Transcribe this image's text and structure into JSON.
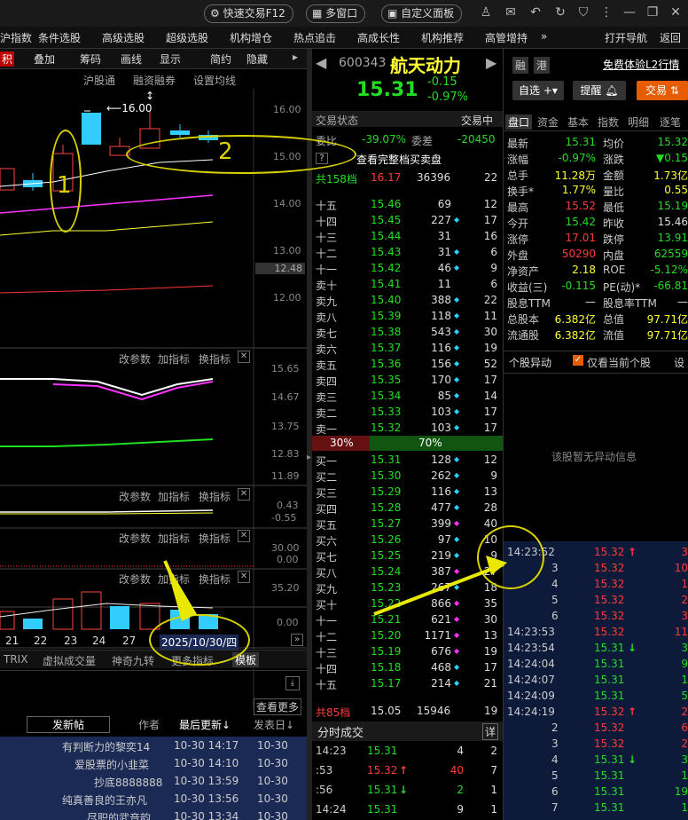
{
  "topbar": {
    "quick_trade": "快速交易F12",
    "multi_window": "多窗口",
    "custom_panel": "自定义面板"
  },
  "menu": [
    "沪指数",
    "条件选股",
    "高级选股",
    "超级选股",
    "机构增仓",
    "热点追击",
    "高成长性",
    "机构推荐",
    "高管增持",
    "»",
    "打开导航",
    "返回"
  ],
  "chart_toolbar": [
    "积",
    "叠加",
    "筹码",
    "画线",
    "显示",
    "简约",
    "隐藏"
  ],
  "chart_links": [
    "沪股通",
    "融资融券",
    "设置均线"
  ],
  "price_axis": [
    "16.00",
    "15.00",
    "14.00",
    "13.00",
    "12.48",
    "12.00"
  ],
  "peak_label": "16.00",
  "ind_buttons": {
    "params": "改参数",
    "add": "加指标",
    "switch": "换指标"
  },
  "ind_axis1": [
    "15.65",
    "14.67",
    "13.75",
    "12.83",
    "11.89"
  ],
  "ind_axis2": [
    "0.43",
    "-0.55"
  ],
  "ind_axis3": [
    "30.00",
    "0.00"
  ],
  "ind_axis4": [
    "35.20",
    "0.00"
  ],
  "dates": [
    "21",
    "22",
    "23",
    "24",
    "27"
  ],
  "date_tooltip": "2025/10/30/四",
  "bottom_tabs": [
    "TRIX",
    "虚拟成交量",
    "神奇九转",
    "更多指标",
    "模板"
  ],
  "forum": {
    "post_btn": "发新帖",
    "author": "作者",
    "last_update": "最后更新",
    "post_date": "发表日",
    "view_more": "查看更多",
    "rows": [
      {
        "author": "有判断力的黎奕14",
        "time": "10-30  14:17",
        "date": "10-30"
      },
      {
        "author": "爱股票的小韭菜",
        "time": "10-30  14:10",
        "date": "10-30"
      },
      {
        "author": "抄底8888888",
        "time": "10-30  13:59",
        "date": "10-30"
      },
      {
        "author": "纯真善良的王亦凡",
        "time": "10-30  13:56",
        "date": "10-30"
      },
      {
        "author": "尽职的武音韵",
        "time": "10-30  13:34",
        "date": "10-30"
      }
    ]
  },
  "stock": {
    "code": "600343",
    "name": "航天动力",
    "price": "15.31",
    "change": "-0.15",
    "pct": "-0.97%",
    "tags": [
      "融",
      "港"
    ],
    "l2": "免费体验L2行情",
    "zixuan": "自选",
    "remind": "提醒",
    "trade": "交易"
  },
  "trade_status": {
    "label": "交易状态",
    "value": "交易中"
  },
  "weibi": {
    "label1": "委比",
    "v1": "-39.07%",
    "label2": "委差",
    "v2": "-20450"
  },
  "full_book": "查看完整档买卖盘",
  "ask_total": {
    "label": "共158档",
    "price": "16.17",
    "vol": "36396",
    "n": "22"
  },
  "asks": [
    {
      "l": "十五",
      "p": "15.46",
      "v": "69",
      "d": "",
      "n": "12"
    },
    {
      "l": "十四",
      "p": "15.45",
      "v": "227",
      "d": "c",
      "n": "17"
    },
    {
      "l": "十三",
      "p": "15.44",
      "v": "31",
      "d": "",
      "n": "16"
    },
    {
      "l": "十二",
      "p": "15.43",
      "v": "31",
      "d": "c",
      "n": "6"
    },
    {
      "l": "十一",
      "p": "15.42",
      "v": "46",
      "d": "c",
      "n": "9"
    },
    {
      "l": "卖十",
      "p": "15.41",
      "v": "11",
      "d": "",
      "n": "6"
    },
    {
      "l": "卖九",
      "p": "15.40",
      "v": "388",
      "d": "c",
      "n": "22"
    },
    {
      "l": "卖八",
      "p": "15.39",
      "v": "118",
      "d": "c",
      "n": "11"
    },
    {
      "l": "卖七",
      "p": "15.38",
      "v": "543",
      "d": "c",
      "n": "30"
    },
    {
      "l": "卖六",
      "p": "15.37",
      "v": "116",
      "d": "c",
      "n": "19"
    },
    {
      "l": "卖五",
      "p": "15.36",
      "v": "156",
      "d": "c",
      "n": "52"
    },
    {
      "l": "卖四",
      "p": "15.35",
      "v": "170",
      "d": "c",
      "n": "17"
    },
    {
      "l": "卖三",
      "p": "15.34",
      "v": "85",
      "d": "c",
      "n": "14"
    },
    {
      "l": "卖二",
      "p": "15.33",
      "v": "103",
      "d": "c",
      "n": "17"
    },
    {
      "l": "卖一",
      "p": "15.32",
      "v": "103",
      "d": "c",
      "n": "17"
    }
  ],
  "ratio": {
    "sell": "30%",
    "buy": "70%",
    "sell_frac": 0.3
  },
  "bids": [
    {
      "l": "买一",
      "p": "15.31",
      "v": "128",
      "d": "c",
      "n": "12"
    },
    {
      "l": "买二",
      "p": "15.30",
      "v": "262",
      "d": "c",
      "n": "9"
    },
    {
      "l": "买三",
      "p": "15.29",
      "v": "116",
      "d": "c",
      "n": "13"
    },
    {
      "l": "买四",
      "p": "15.28",
      "v": "477",
      "d": "c",
      "n": "28"
    },
    {
      "l": "买五",
      "p": "15.27",
      "v": "399",
      "d": "m",
      "n": "40"
    },
    {
      "l": "买六",
      "p": "15.26",
      "v": "97",
      "d": "c",
      "n": "10"
    },
    {
      "l": "买七",
      "p": "15.25",
      "v": "219",
      "d": "c",
      "n": "9"
    },
    {
      "l": "买八",
      "p": "15.24",
      "v": "387",
      "d": "m",
      "n": "27"
    },
    {
      "l": "买九",
      "p": "15.23",
      "v": "267",
      "d": "c",
      "n": "18"
    },
    {
      "l": "买十",
      "p": "15.22",
      "v": "866",
      "d": "m",
      "n": "35"
    },
    {
      "l": "十一",
      "p": "15.21",
      "v": "621",
      "d": "m",
      "n": "30"
    },
    {
      "l": "十二",
      "p": "15.20",
      "v": "1171",
      "d": "m",
      "n": "13"
    },
    {
      "l": "十三",
      "p": "15.19",
      "v": "676",
      "d": "m",
      "n": "19"
    },
    {
      "l": "十四",
      "p": "15.18",
      "v": "468",
      "d": "c",
      "n": "17"
    },
    {
      "l": "十五",
      "p": "15.17",
      "v": "214",
      "d": "c",
      "n": "21"
    }
  ],
  "bid_total": {
    "label": "共85档",
    "price": "15.05",
    "vol": "15946",
    "n": "19"
  },
  "fenshi": {
    "label": "分时成交",
    "detail": "详"
  },
  "ticks_mid": [
    {
      "t": "14:23",
      "p": "15.31",
      "a": "",
      "v": "4",
      "n": "2"
    },
    {
      "t": ":53",
      "p": "15.32",
      "a": "up",
      "v": "40",
      "n": "7"
    },
    {
      "t": ":56",
      "p": "15.31",
      "a": "dn",
      "v": "2",
      "n": "1"
    },
    {
      "t": "14:24",
      "p": "15.31",
      "a": "",
      "v": "9",
      "n": "1"
    }
  ],
  "right_tabs": [
    "盘口",
    "资金",
    "基本",
    "指数",
    "明细",
    "逐笔"
  ],
  "quote": [
    [
      "最新",
      "15.31",
      "均价",
      "15.32"
    ],
    [
      "涨幅",
      "-0.97%",
      "涨跌",
      "▼0.15"
    ],
    [
      "总手",
      "11.28万",
      "金额",
      "1.73亿"
    ],
    [
      "换手*",
      "1.77%",
      "量比",
      "0.55"
    ],
    [
      "最高",
      "15.52",
      "最低",
      "15.19"
    ],
    [
      "今开",
      "15.42",
      "昨收",
      "15.46"
    ],
    [
      "涨停",
      "17.01",
      "跌停",
      "13.91"
    ],
    [
      "外盘",
      "50290",
      "内盘",
      "62559"
    ],
    [
      "净资产",
      "2.18",
      "ROE",
      "-5.12%"
    ],
    [
      "收益(三)",
      "-0.115",
      "PE(动)*",
      "-66.81"
    ],
    [
      "股息TTM",
      "—",
      "股息率TTM",
      "—"
    ],
    [
      "总股本",
      "6.382亿",
      "总值",
      "97.71亿"
    ],
    [
      "流通股",
      "6.382亿",
      "流值",
      "97.71亿"
    ]
  ],
  "abnormal": {
    "title": "个股异动",
    "check": "仅看当前个股",
    "set": "设",
    "empty": "该股暂无异动信息"
  },
  "ticks_right": [
    {
      "t": "14:23:52",
      "p": "15.32",
      "a": "up",
      "v": "3"
    },
    {
      "t": "3",
      "p": "15.32",
      "a": "",
      "v": "10"
    },
    {
      "t": "4",
      "p": "15.32",
      "a": "",
      "v": "1"
    },
    {
      "t": "5",
      "p": "15.32",
      "a": "",
      "v": "2"
    },
    {
      "t": "6",
      "p": "15.32",
      "a": "",
      "v": "3"
    },
    {
      "t": "14:23:53",
      "p": "15.32",
      "a": "",
      "v": "11"
    },
    {
      "t": "14:23:54",
      "p": "15.31",
      "a": "dn",
      "v": "3"
    },
    {
      "t": "14:24:04",
      "p": "15.31",
      "a": "",
      "v": "9"
    },
    {
      "t": "14:24:07",
      "p": "15.31",
      "a": "",
      "v": "1"
    },
    {
      "t": "14:24:09",
      "p": "15.31",
      "a": "",
      "v": "5"
    },
    {
      "t": "14:24:19",
      "p": "15.32",
      "a": "up",
      "v": "2"
    },
    {
      "t": "2",
      "p": "15.32",
      "a": "",
      "v": "6"
    },
    {
      "t": "3",
      "p": "15.32",
      "a": "",
      "v": "2"
    },
    {
      "t": "4",
      "p": "15.31",
      "a": "dn",
      "v": "3"
    },
    {
      "t": "5",
      "p": "15.31",
      "a": "",
      "v": "1"
    },
    {
      "t": "6",
      "p": "15.31",
      "a": "",
      "v": "19"
    },
    {
      "t": "7",
      "p": "15.31",
      "a": "",
      "v": "1"
    }
  ],
  "annotations": [
    "1",
    "2"
  ]
}
